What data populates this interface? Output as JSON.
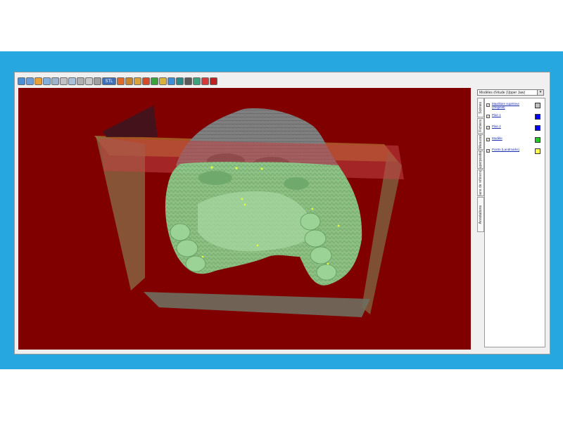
{
  "toolbar": {
    "buttons": [
      {
        "name": "open-icon",
        "color": "#4b8fd6"
      },
      {
        "name": "zoom-in-icon",
        "color": "#6a9fd8"
      },
      {
        "name": "zoom-out-icon",
        "color": "#e8a13a"
      },
      {
        "name": "rotate-icon",
        "color": "#7fb0e0"
      },
      {
        "name": "fit-icon",
        "color": "#9ab3c9"
      },
      {
        "name": "view-front-icon",
        "color": "#c0c0c0"
      },
      {
        "name": "view-side-icon",
        "color": "#a8c0d8"
      },
      {
        "name": "view-top-icon",
        "color": "#b0b0b0"
      },
      {
        "name": "measure-icon",
        "color": "#c8c8c8"
      },
      {
        "name": "section-icon",
        "color": "#a0a0a0"
      },
      {
        "name": "stl-icon",
        "color": "#3f6fb8",
        "label": "STL"
      },
      {
        "name": "pencil-icon",
        "color": "#e06a2a"
      },
      {
        "name": "brush-icon",
        "color": "#c8862a"
      },
      {
        "name": "layer-icon",
        "color": "#d9a23b"
      },
      {
        "name": "color-icon",
        "color": "#d94a2a"
      },
      {
        "name": "check-icon",
        "color": "#3aa53a"
      },
      {
        "name": "lock-icon",
        "color": "#d8b23a"
      },
      {
        "name": "camera-icon",
        "color": "#3a8fd8"
      },
      {
        "name": "screen-icon",
        "color": "#2a8a8a"
      },
      {
        "name": "print-icon",
        "color": "#5a5a5a"
      },
      {
        "name": "export-icon",
        "color": "#3aa57a"
      },
      {
        "name": "settings-icon",
        "color": "#d83a3a"
      },
      {
        "name": "close-icon",
        "color": "#c02020"
      }
    ]
  },
  "right_panel": {
    "dropdown_value": "Modèles d'étude (Upper Jaw)",
    "tabs": [
      "Scènes",
      "Fichiers",
      "Mesures",
      "Superposition",
      "Plans de référence",
      "Annotations"
    ],
    "layers": [
      {
        "label": "Maxillaire supérieur (Original)",
        "color": "#bfbfbf",
        "checked": true
      },
      {
        "label": "Plan 1",
        "color": "#0000ff",
        "checked": true
      },
      {
        "label": "Plan 2",
        "color": "#0000ff",
        "checked": true
      },
      {
        "label": "Modèle",
        "color": "#22cc22",
        "checked": true
      },
      {
        "label": "Points (Landmarks)",
        "color": "#ffff44",
        "checked": true
      }
    ]
  },
  "viewport": {
    "background_color": "#800000",
    "model_color": "#8dc98a",
    "landmark_color": "#e7ff3a"
  }
}
